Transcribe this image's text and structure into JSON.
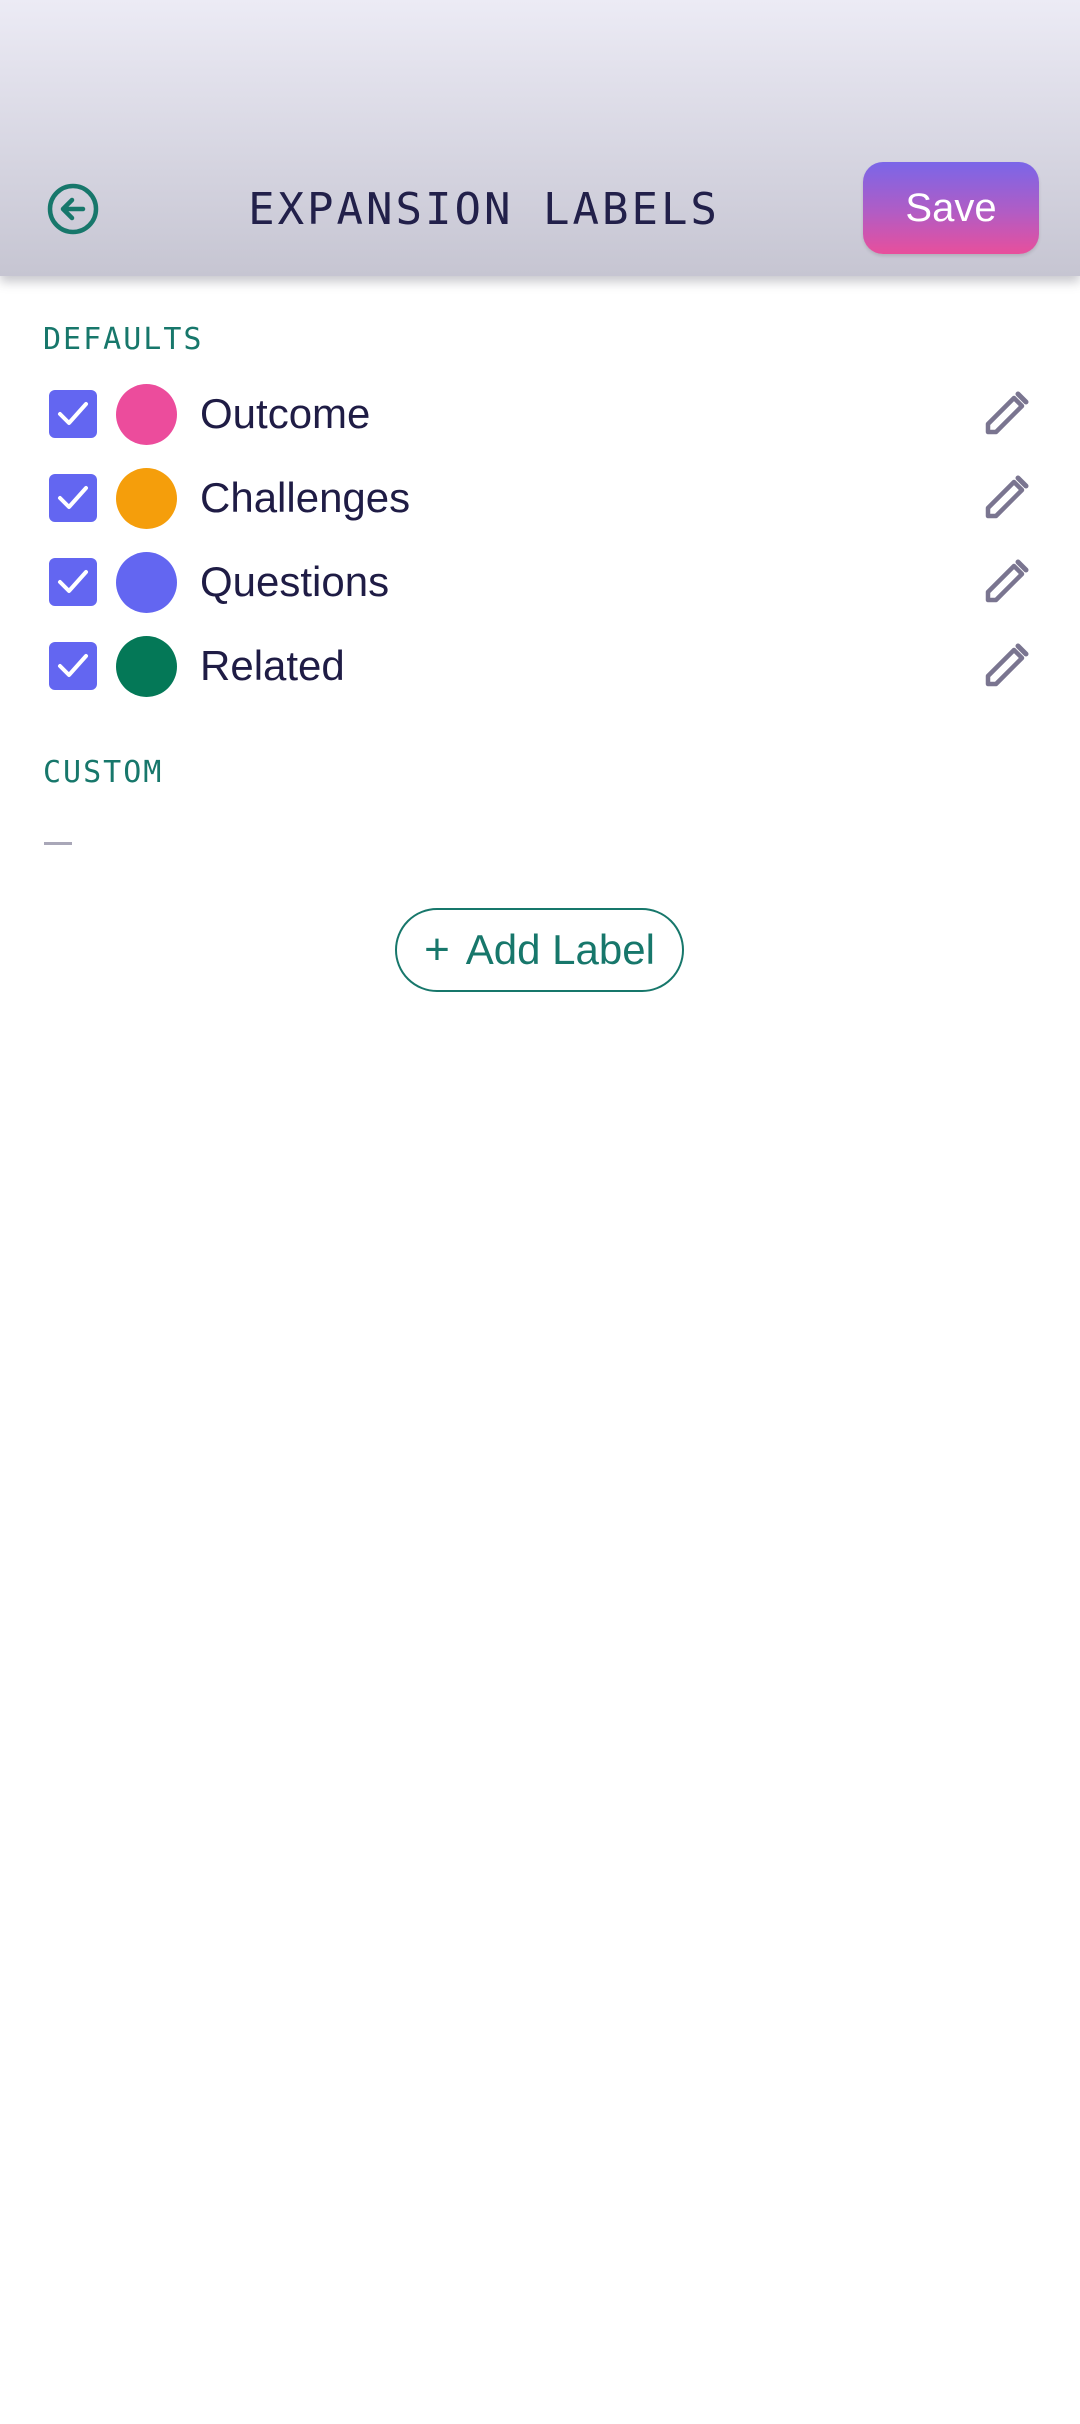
{
  "header": {
    "title": "EXPANSION LABELS",
    "save_label": "Save"
  },
  "sections": {
    "defaults_title": "DEFAULTS",
    "custom_title": "CUSTOM"
  },
  "defaults": [
    {
      "label": "Outcome",
      "color": "#ec4c9c",
      "checked": true
    },
    {
      "label": "Challenges",
      "color": "#f59e0b",
      "checked": true
    },
    {
      "label": "Questions",
      "color": "#6366f1",
      "checked": true
    },
    {
      "label": "Related",
      "color": "#047857",
      "checked": true
    }
  ],
  "custom": {
    "empty_text": "—"
  },
  "add_button": {
    "plus": "+",
    "label": "Add Label"
  },
  "colors": {
    "accent": "#17776b",
    "checkbox": "#6366f1",
    "title": "#22204a",
    "icon_muted": "#7a7590"
  },
  "icons": {
    "back": "back-circle-arrow-icon",
    "check": "check-icon",
    "edit": "pencil-icon"
  }
}
